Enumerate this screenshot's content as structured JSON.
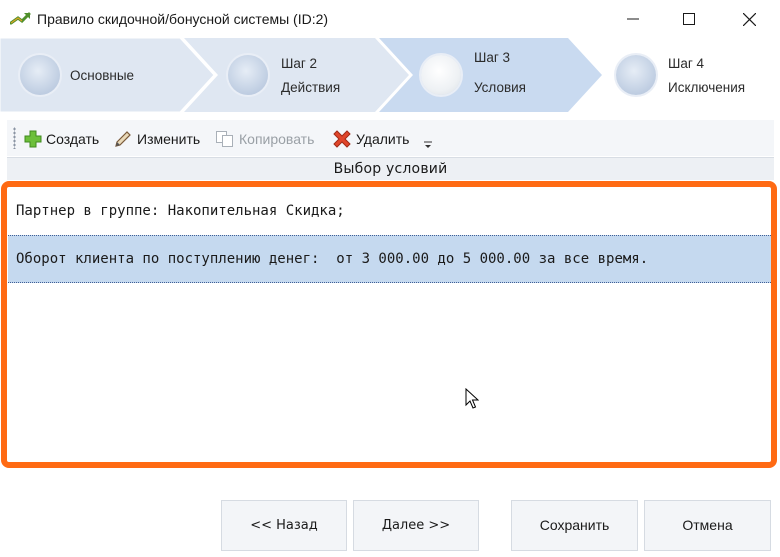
{
  "window": {
    "title": "Правило скидочной/бонусной системы (ID:2)",
    "minimize_symbol": "—",
    "maximize_symbol": "☐",
    "close_symbol": "✕"
  },
  "steps": [
    {
      "label": "Основные",
      "sub": "",
      "active": false
    },
    {
      "label": "Шаг 2",
      "sub": "Действия",
      "active": false
    },
    {
      "label": "Шаг 3",
      "sub": "Условия",
      "active": true
    },
    {
      "label": "Шаг 4",
      "sub": "Исключения",
      "active": false
    }
  ],
  "toolbar": {
    "create_label": "Создать",
    "edit_label": "Изменить",
    "copy_label": "Копировать",
    "delete_label": "Удалить"
  },
  "section": {
    "title": "Выбор условий"
  },
  "conditions": [
    "Партнер в группе: Накопительная Скидка;",
    "Оборот клиента по поступлению денег:  от 3 000.00 до 5 000.00 за все время."
  ],
  "buttons": {
    "back": "<< Назад",
    "next": "Далее >>",
    "save": "Сохранить",
    "cancel": "Отмена"
  },
  "colors": {
    "highlight_border": "#ff6a13",
    "selected_row": "#c5d9ef",
    "active_step": "#c9daf0"
  }
}
